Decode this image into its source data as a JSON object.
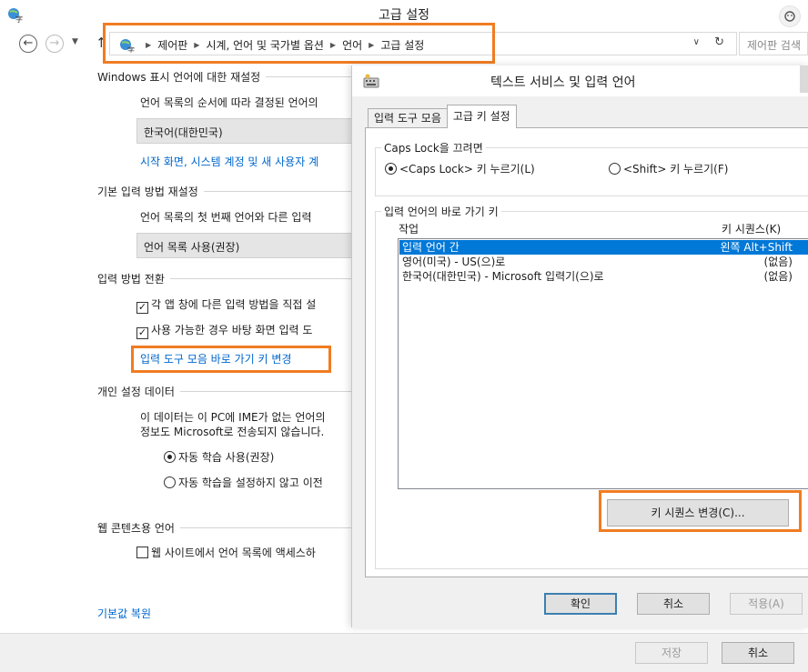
{
  "window": {
    "title": "고급 설정"
  },
  "nav": {
    "breadcrumbs": [
      "제어판",
      "시계, 언어 및 국가별 옵션",
      "언어",
      "고급 설정"
    ],
    "search_placeholder": "제어판 검색"
  },
  "sections": {
    "display_language": {
      "heading": "Windows 표시 언어에 대한 재설정",
      "desc": "언어 목록의 순서에 따라 결정된 언어의",
      "selected": "한국어(대한민국)",
      "link": "시작 화면, 시스템 계정 및 새 사용자 계"
    },
    "default_input": {
      "heading": "기본 입력 방법 재설정",
      "desc": "언어 목록의 첫 번째 언어와 다른 입력",
      "selected": "언어 목록 사용(권장)"
    },
    "switching": {
      "heading": "입력 방법 전환",
      "checkbox1": "각 앱 창에 다른 입력 방법을 직접 설",
      "checkbox2": "사용 가능한 경우 바탕 화면 입력 도",
      "link": "입력 도구 모음 바로 가기 키 변경"
    },
    "personalization": {
      "heading": "개인 설정 데이터",
      "desc_line1": "이 데이터는 이 PC에 IME가 없는 언어의",
      "desc_line2": "정보도 Microsoft로 전송되지 않습니다.",
      "radio1": "자동 학습 사용(권장)",
      "radio2": "자동 학습을 설정하지 않고 이전"
    },
    "web_content": {
      "heading": "웹 콘텐츠용 언어",
      "checkbox": "웹 사이트에서 언어 목록에 액세스하"
    },
    "restore_link": "기본값 복원"
  },
  "footer": {
    "save": "저장",
    "cancel": "취소"
  },
  "dialog": {
    "title": "텍스트 서비스 및 입력 언어",
    "tabs": [
      "입력 도구 모음",
      "고급 키 설정"
    ],
    "caps_group": {
      "legend": "Caps Lock을 끄려면",
      "option1": "<Caps Lock> 키 누르기(L)",
      "option2": "<Shift> 키 누르기(F)"
    },
    "hotkey_group": {
      "legend": "입력 언어의 바로 가기 키",
      "col_action": "작업",
      "col_sequence": "키 시퀀스(K)",
      "rows": [
        {
          "action": "입력 언어 간",
          "sequence": "왼쪽 Alt+Shift"
        },
        {
          "action": "영어(미국) - US(으)로",
          "sequence": "(없음)"
        },
        {
          "action": "한국어(대한민국) - Microsoft 입력기(으)로",
          "sequence": "(없음)"
        }
      ]
    },
    "change_sequence_button": "키 시퀀스 변경(C)...",
    "buttons": {
      "ok": "확인",
      "cancel": "취소",
      "apply": "적용(A)"
    }
  },
  "colors": {
    "highlight": "#f07c22",
    "link": "#0066cc",
    "selection": "#0078d7"
  }
}
